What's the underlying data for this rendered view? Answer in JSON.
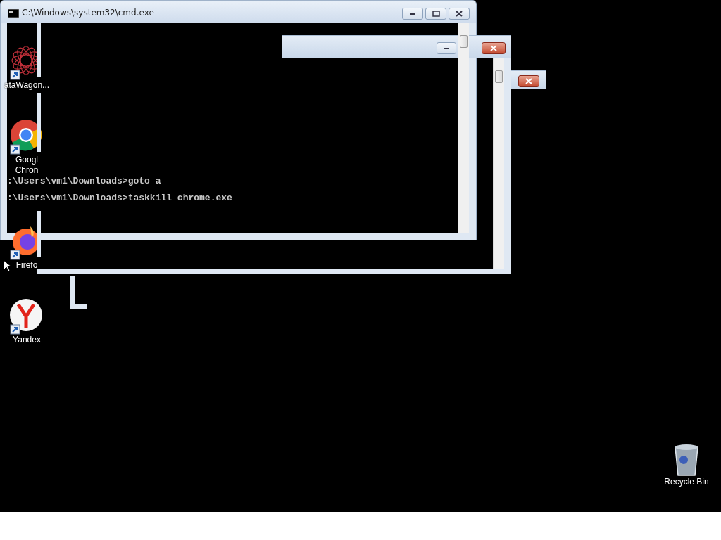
{
  "desktop_icons": [
    {
      "kind": "star",
      "lines": [
        "ataWagon..."
      ]
    },
    {
      "kind": "chrome",
      "lines": [
        "Googl",
        "Chron"
      ]
    },
    {
      "kind": "firefox",
      "lines": [
        "Firefo"
      ]
    },
    {
      "kind": "yandex",
      "lines": [
        "Yandex"
      ]
    }
  ],
  "recycle_bin": {
    "label": "Recycle Bin"
  },
  "cmd_window": {
    "title": "C:\\Windows\\system32\\cmd.exe",
    "lines": [
      ":\\Users\\vm1\\Downloads>goto a",
      ":\\Users\\vm1\\Downloads>taskkill chrome.exe"
    ]
  }
}
